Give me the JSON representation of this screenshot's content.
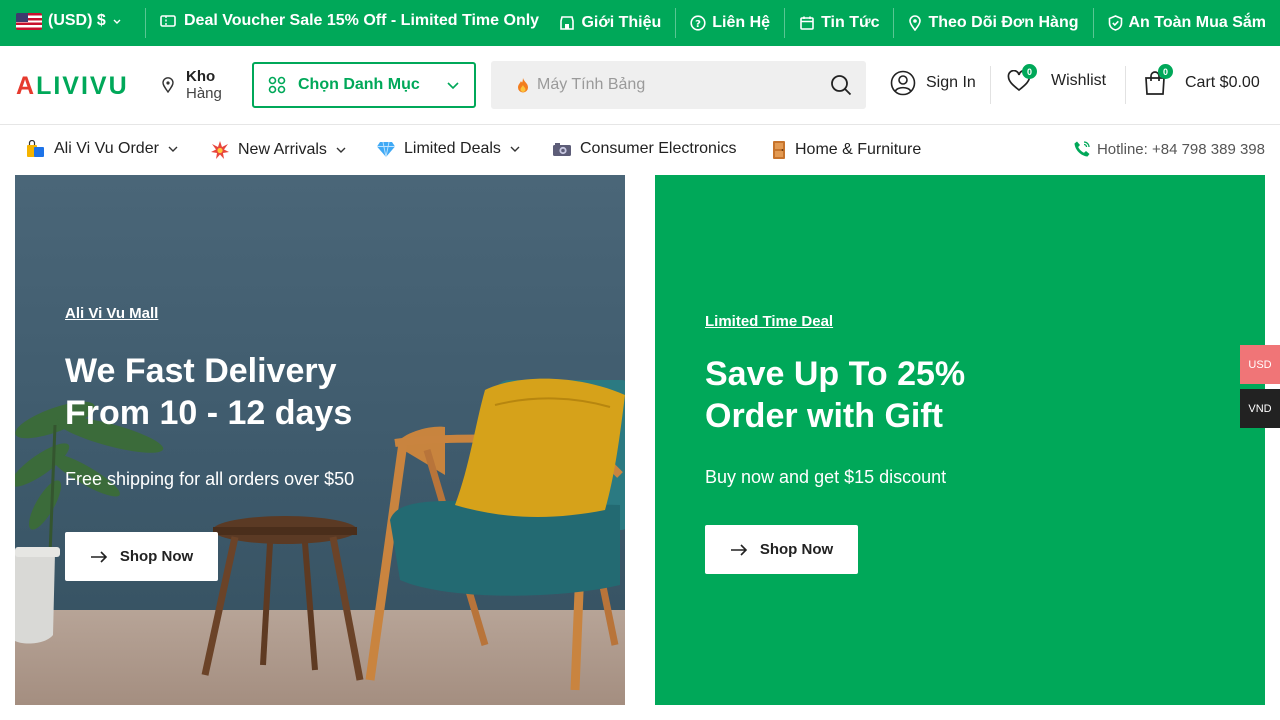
{
  "topbar": {
    "currency": "(USD) $",
    "deal": "Deal Voucher Sale 15% Off - Limited Time Only",
    "links": [
      {
        "label": "Giới Thiệu",
        "icon": "store-icon"
      },
      {
        "label": "Liên Hệ",
        "icon": "help-circle-icon"
      },
      {
        "label": "Tin Tức",
        "icon": "calendar-icon"
      },
      {
        "label": "Theo Dõi Đơn Hàng",
        "icon": "location-pin-icon"
      },
      {
        "label": "An Toàn Mua Sắm",
        "icon": "shield-check-icon"
      }
    ]
  },
  "header": {
    "logo": "ALIVIVU",
    "warehouse_line1": "Kho",
    "warehouse_line2": "Hàng",
    "category_button": "Chọn Danh Mục",
    "search_placeholder": "Máy Tính Bảng",
    "sign_in": "Sign In",
    "wishlist": "Wishlist",
    "wishlist_count": "0",
    "cart": "Cart $0.00",
    "cart_count": "0"
  },
  "nav": {
    "items": [
      {
        "label": "Ali Vi Vu Order",
        "dropdown": true
      },
      {
        "label": "New Arrivals",
        "dropdown": true
      },
      {
        "label": "Limited Deals",
        "dropdown": true
      },
      {
        "label": "Consumer Electronics",
        "dropdown": false
      },
      {
        "label": "Home & Furniture",
        "dropdown": false
      }
    ],
    "hotline": "Hotline: +84 798 389 398"
  },
  "banners": [
    {
      "subtitle": "Ali Vi Vu Mall",
      "title": "We Fast Delivery From 10 - 12 days",
      "desc": "Free shipping for all orders over $50",
      "button": "Shop Now"
    },
    {
      "subtitle": "Limited Time Deal",
      "title": "Save Up To 25% Order with Gift",
      "desc": "Buy now and get $15 discount",
      "button": "Shop Now"
    }
  ],
  "side_currency": {
    "usd": "USD",
    "vnd": "VND"
  },
  "colors": {
    "brand": "#00a859",
    "accent_red": "#e63a2e",
    "usd_tab": "#f07577"
  }
}
